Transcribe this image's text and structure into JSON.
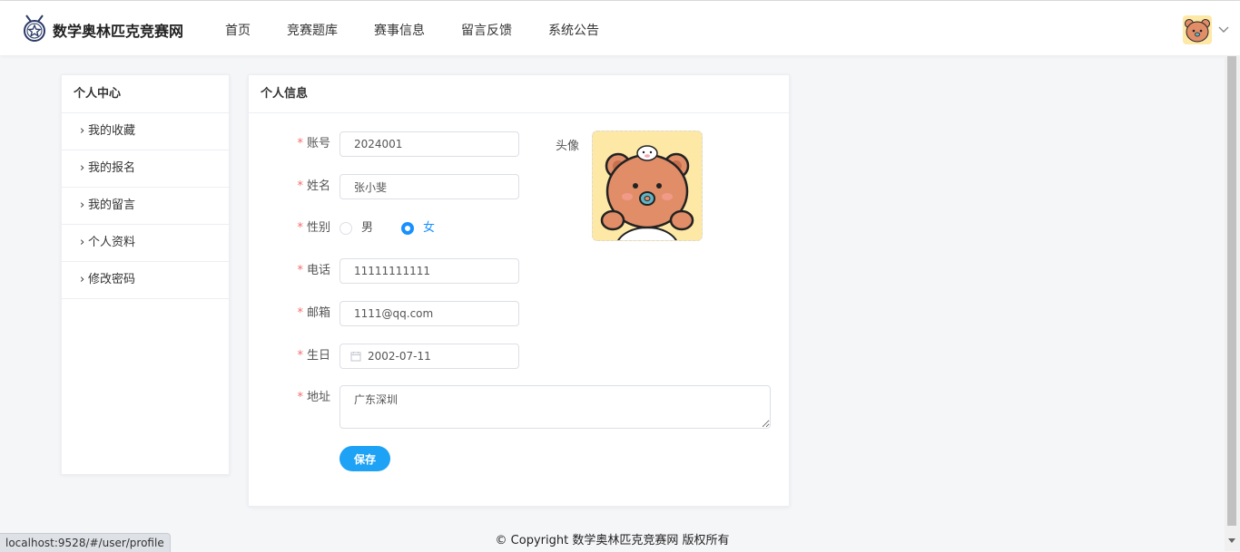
{
  "header": {
    "site_name": "数学奥林匹克竞赛网",
    "nav": [
      "首页",
      "竞赛题库",
      "赛事信息",
      "留言反馈",
      "系统公告"
    ]
  },
  "sidebar": {
    "title": "个人中心",
    "items": [
      {
        "label": "我的收藏"
      },
      {
        "label": "我的报名"
      },
      {
        "label": "我的留言"
      },
      {
        "label": "个人资料"
      },
      {
        "label": "修改密码"
      }
    ]
  },
  "profile": {
    "title": "个人信息",
    "required_mark": "*",
    "account": {
      "label": "账号",
      "value": "2024001"
    },
    "name": {
      "label": "姓名",
      "value": "张小斐"
    },
    "gender": {
      "label": "性别",
      "options": [
        "男",
        "女"
      ],
      "selected": "女"
    },
    "phone": {
      "label": "电话",
      "value": "11111111111"
    },
    "email": {
      "label": "邮箱",
      "value": "1111@qq.com"
    },
    "birthday": {
      "label": "生日",
      "value": "2002-07-11"
    },
    "address": {
      "label": "地址",
      "value": "广东深圳"
    },
    "avatar_label": "头像",
    "save_label": "保存"
  },
  "footer": {
    "copyright": "© Copyright 数学奥林匹克竞赛网 版权所有"
  },
  "status_bar": {
    "url": "localhost:9528/#/user/profile"
  },
  "colors": {
    "accent": "#1890ff",
    "button": "#1ea2f5",
    "required": "#f56c6c"
  }
}
